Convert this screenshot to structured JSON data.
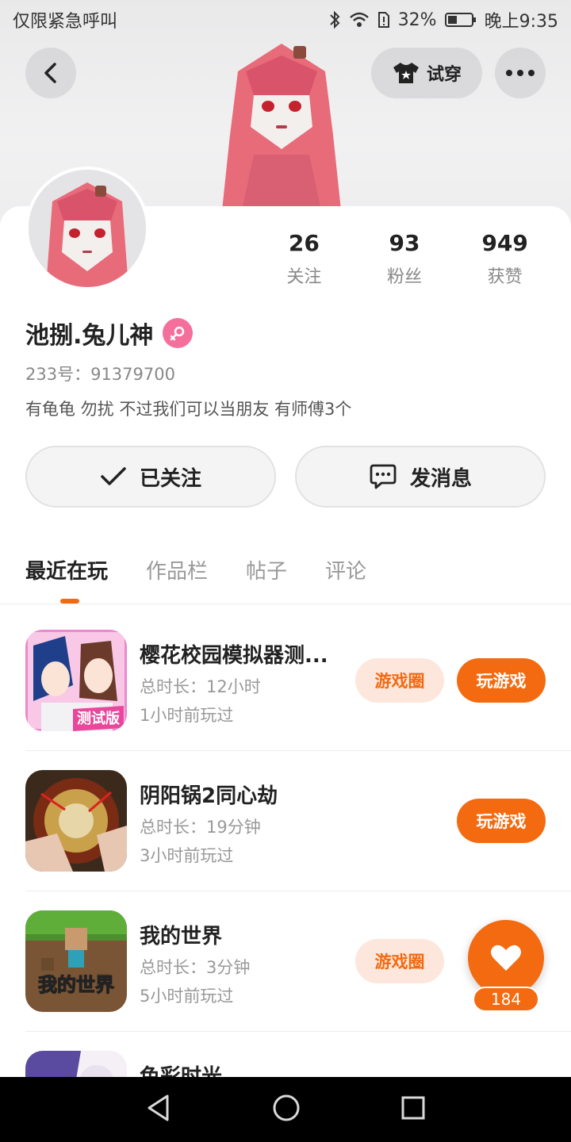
{
  "statusbar": {
    "carrier": "仅限紧急呼叫",
    "battery_pct": "32%",
    "time": "晚上9:35"
  },
  "header": {
    "tryon_label": "试穿"
  },
  "stats": [
    {
      "num": "26",
      "label": "关注"
    },
    {
      "num": "93",
      "label": "粉丝"
    },
    {
      "num": "949",
      "label": "获赞"
    }
  ],
  "profile": {
    "name": "池捌.兔儿神",
    "uid": "233号：91379700",
    "bio": "有龟龟 勿扰 不过我们可以当朋友 有师傅3个"
  },
  "actions": {
    "follow_label": "已关注",
    "message_label": "发消息"
  },
  "tabs": [
    {
      "label": "最近在玩"
    },
    {
      "label": "作品栏"
    },
    {
      "label": "帖子"
    },
    {
      "label": "评论"
    }
  ],
  "games": [
    {
      "title": "樱花校园模拟器测...",
      "duration": "总时长：12小时",
      "last_played": "1小时前玩过",
      "circle_label": "游戏圈",
      "play_label": "玩游戏",
      "icon_text": "测试版"
    },
    {
      "title": "阴阳锅2同心劫",
      "duration": "总时长：19分钟",
      "last_played": "3小时前玩过",
      "play_label": "玩游戏"
    },
    {
      "title": "我的世界",
      "duration": "总时长：3分钟",
      "last_played": "5小时前玩过",
      "circle_label": "游戏圈",
      "icon_text": "我的世界"
    },
    {
      "title": "色彩时光"
    }
  ],
  "float_like": {
    "count": "184"
  },
  "colors": {
    "accent": "#f36a10",
    "gender_female": "#f46f9b"
  }
}
